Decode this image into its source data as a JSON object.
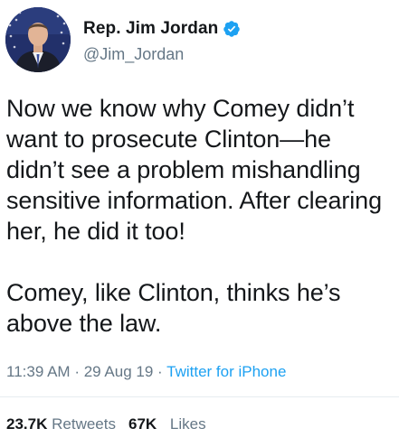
{
  "user": {
    "display_name": "Rep. Jim Jordan",
    "handle": "@Jim_Jordan",
    "verified": true,
    "avatar_icon": "profile-photo-icon",
    "verified_icon": "verified-badge-icon",
    "verified_color": "#1da1f2"
  },
  "tweet": {
    "text": "Now we know why Comey didn’t want to prosecute Clinton—he didn’t see a problem mishandling sensitive information. After clearing her, he did it too!\n\nComey, like Clinton, thinks he’s above the law.",
    "time": "11:39 AM",
    "date": "29 Aug 19",
    "separator": "·",
    "source": "Twitter for iPhone"
  },
  "stats": {
    "retweets_count": "23.7K",
    "retweets_label": "Retweets",
    "likes_count": "67K",
    "likes_label": "Likes"
  },
  "colors": {
    "text": "#14171a",
    "secondary": "#657786",
    "link": "#1da1f2",
    "divider": "#e6ecf0"
  }
}
